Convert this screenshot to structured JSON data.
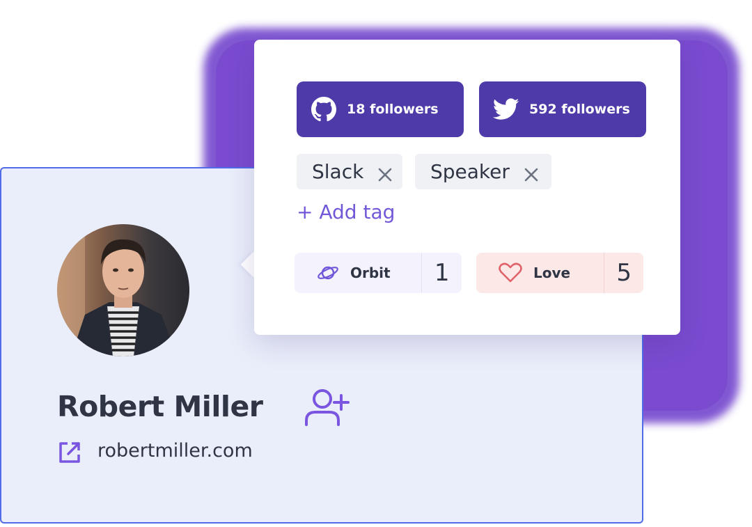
{
  "profile": {
    "name": "Robert Miller",
    "website": "robertmiller.com"
  },
  "social": {
    "github_label": "18 followers",
    "twitter_label": "592 followers"
  },
  "tags": [
    {
      "label": "Slack"
    },
    {
      "label": "Speaker"
    }
  ],
  "add_tag_label": "+ Add tag",
  "reactions": {
    "orbit": {
      "label": "Orbit",
      "count": "1"
    },
    "love": {
      "label": "Love",
      "count": "5"
    }
  },
  "colors": {
    "accent": "#4e3aa8",
    "glow": "#7a4bcf",
    "link": "#7258d8",
    "love_bg": "#fde8e8",
    "card_bg": "#e9eefa"
  },
  "icons": [
    "github-icon",
    "twitter-icon",
    "close-icon",
    "orbit-icon",
    "heart-icon",
    "add-user-icon",
    "external-link-icon"
  ]
}
